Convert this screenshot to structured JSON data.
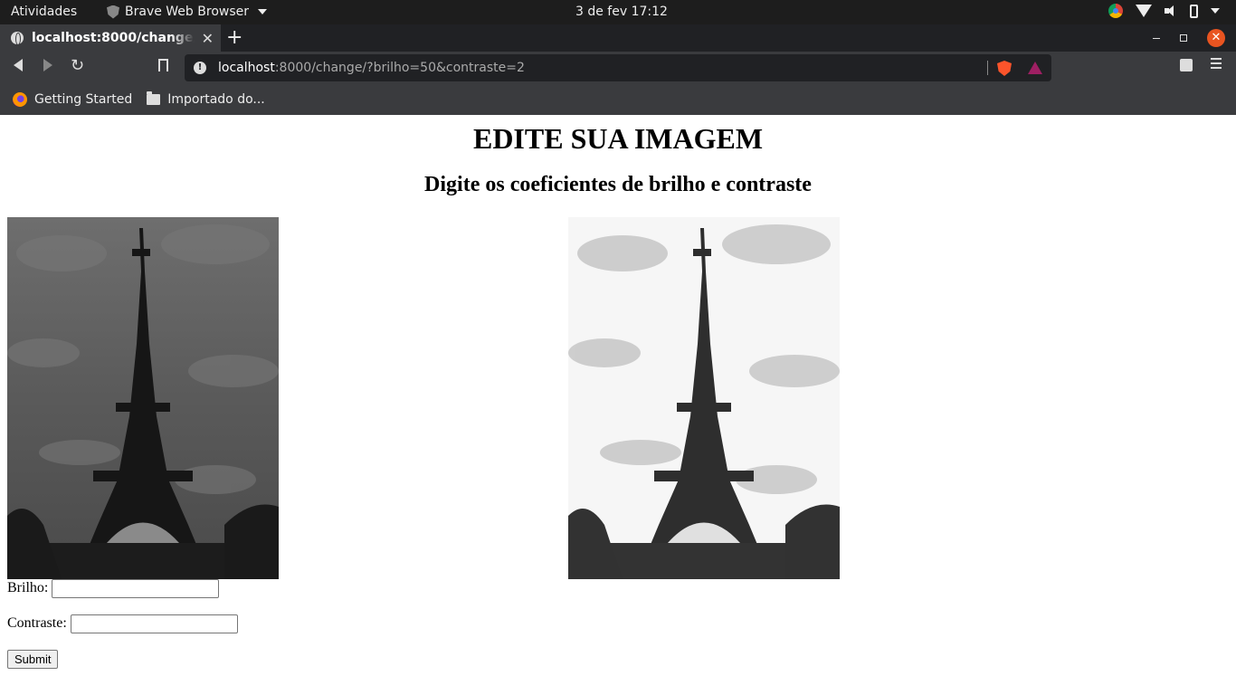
{
  "system_bar": {
    "activities": "Atividades",
    "app_name": "Brave Web Browser",
    "clock": "3 de fev  17:12"
  },
  "browser": {
    "tab_title": "localhost:8000/change/?brilho=50&contraste=2",
    "url_host": "localhost",
    "url_rest": ":8000/change/?brilho=50&contraste=2",
    "bookmarks": [
      {
        "label": "Getting Started"
      },
      {
        "label": "Importado do..."
      }
    ]
  },
  "page": {
    "heading": "EDITE SUA IMAGEM",
    "subheading": "Digite os coeficientes de brilho e contraste",
    "form": {
      "brilho_label": "Brilho:",
      "brilho_value": "",
      "contraste_label": "Contraste:",
      "contraste_value": "",
      "submit_label": "Submit"
    }
  }
}
